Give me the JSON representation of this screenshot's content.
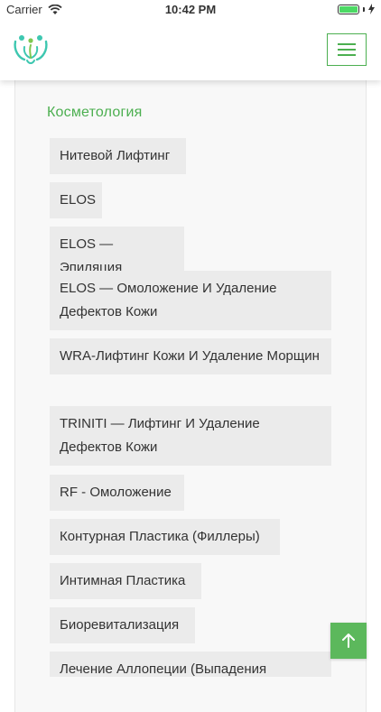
{
  "status_bar": {
    "carrier": "Carrier",
    "time": "10:42 PM"
  },
  "header": {
    "logo_icon": "family-logo-icon",
    "menu_icon": "hamburger-menu-icon"
  },
  "section": {
    "title": "Косметология"
  },
  "services": [
    "Нитевой Лифтинг",
    "ELOS",
    "ELOS — Эпиляция",
    "ELOS — Омоложение И Удаление Дефектов Кожи",
    "WRA-Лифтинг Кожи И Удаление Морщин",
    "TRINITI — Лифтинг И Удаление Дефектов Кожи",
    "RF - Омоложение",
    "Контурная Пластика (Филлеры)",
    "Интимная Пластика",
    "Биоревитализация",
    "Лечение Аллопеции (Выпадения"
  ],
  "scroll_top": {
    "icon": "arrow-up-icon"
  },
  "colors": {
    "accent": "#4caf50",
    "tag_background": "#ebebeb",
    "card_background": "#f8f8f8",
    "scroll_button": "#5cb85c"
  }
}
